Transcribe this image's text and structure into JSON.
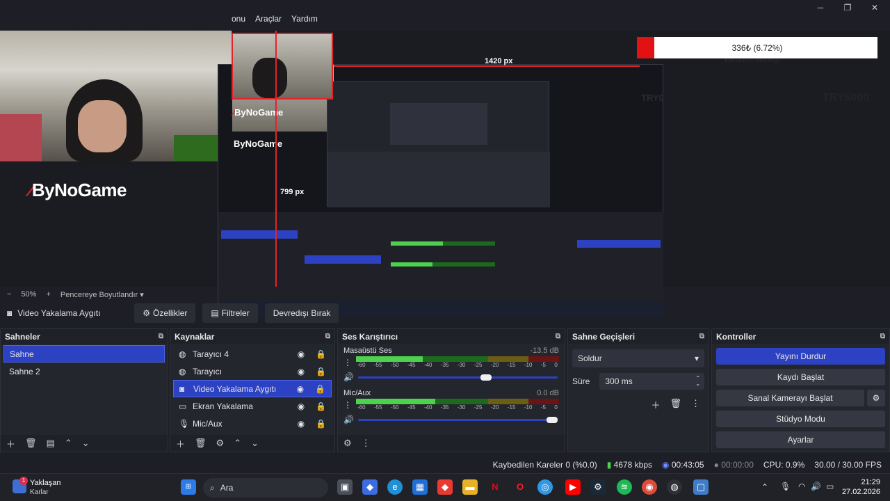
{
  "window": {
    "minimize": "─",
    "maximize": "❐",
    "close": "✕"
  },
  "menu": [
    "onu",
    "Araçlar",
    "Yardım"
  ],
  "preview": {
    "logo_text": "ByNoGame",
    "donation_label": "Ekranım desteği",
    "donation_value": "336₺ (6.72%)",
    "ghost_text": "TRY5000",
    "px_label_top": "1420 px",
    "px_label_mid": "799 px",
    "nested_logo": "ByNoGame",
    "nested_try": "TRY0"
  },
  "zoom": {
    "minus": "−",
    "level": "50%",
    "plus": "+",
    "fit": "Pencereye Boyutlandır"
  },
  "source_toolbar": {
    "source_name": "Video Yakalama Aygıtı",
    "properties": "Özellikler",
    "filters": "Filtreler",
    "deactivate": "Devredışı Bırak"
  },
  "scenes": {
    "title": "Sahneler",
    "items": [
      "Sahne",
      "Sahne 2"
    ],
    "selected": 0
  },
  "sources": {
    "title": "Kaynaklar",
    "items": [
      "Tarayıcı 4",
      "Tarayıcı",
      "Video Yakalama Aygıtı",
      "Ekran Yakalama",
      "Mic/Aux"
    ],
    "selected": 2,
    "icons": [
      "globe-icon",
      "globe-icon",
      "camera-icon",
      "monitor-icon",
      "microphone-icon"
    ]
  },
  "mixer": {
    "title": "Ses Karıştırıcı",
    "channels": [
      {
        "name": "Masaüstü Ses",
        "db": "-13.5 dB",
        "level": 0.33,
        "volume": 0.67
      },
      {
        "name": "Mic/Aux",
        "db": "0.0 dB",
        "level": 0.39,
        "volume": 1.0
      }
    ],
    "ticks": [
      "-60",
      "-55",
      "-50",
      "-45",
      "-40",
      "-35",
      "-30",
      "-25",
      "-20",
      "-15",
      "-10",
      "-5",
      "0"
    ]
  },
  "transitions": {
    "title": "Sahne Geçişleri",
    "selected": "Soldur",
    "duration_label": "Süre",
    "duration": "300 ms"
  },
  "controls": {
    "title": "Kontroller",
    "buttons": [
      "Yayını Durdur",
      "Kaydı Başlat",
      "Sanal Kamerayı Başlat",
      "Stüdyo Modu",
      "Ayarlar"
    ]
  },
  "status": {
    "dropped": "Kaybedilen Kareler 0 (%0.0)",
    "bitrate": "4678 kbps",
    "stream_time": "00:43:05",
    "rec_time": "00:00:00",
    "cpu": "CPU: 0.9%",
    "fps": "30.00 / 30.00 FPS"
  },
  "taskbar": {
    "weather_title": "Yaklaşan",
    "weather_sub": "Karlar",
    "weather_badge": "1",
    "search": "Ara",
    "time": "21:29",
    "date": "27.02.2026"
  },
  "colors": {
    "accent": "#2d42c2",
    "live_red": "#e21212",
    "panel": "#24262e",
    "bg": "#1e1f26"
  }
}
